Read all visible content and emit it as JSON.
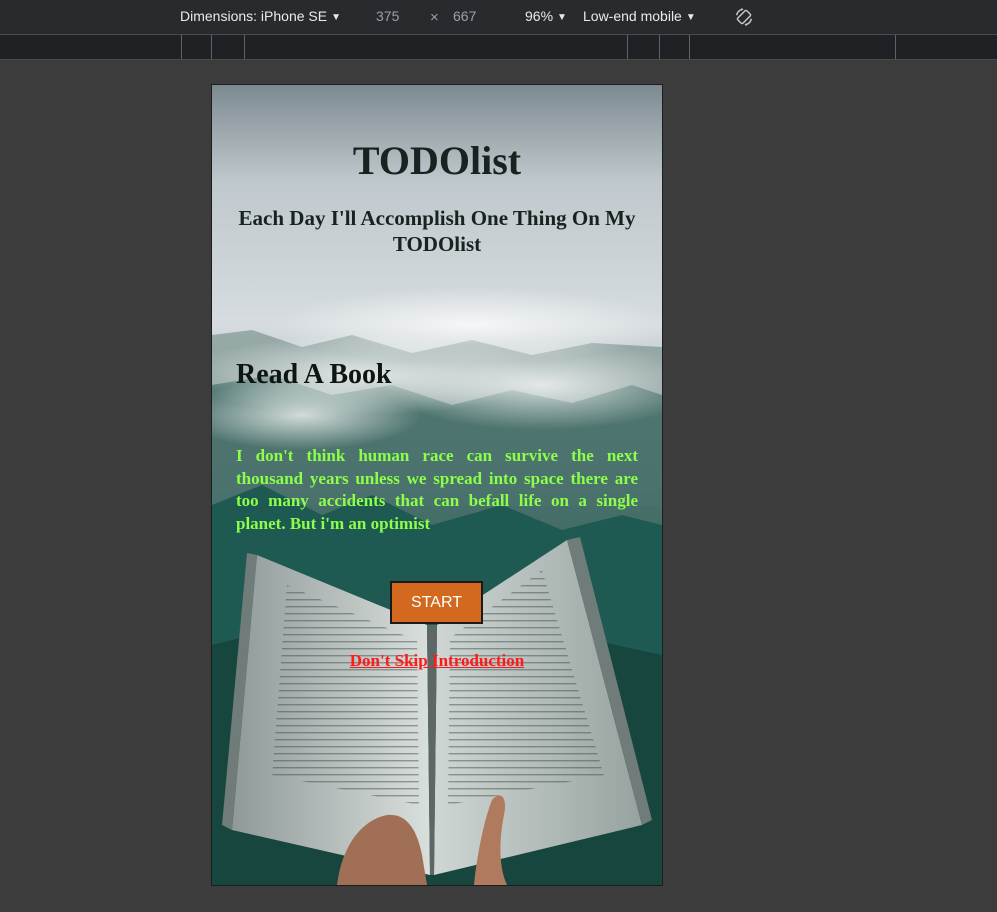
{
  "devtools": {
    "device_label": "Dimensions: iPhone SE",
    "width_value": "375",
    "height_value": "667",
    "zoom": "96%",
    "throttle": "Low-end mobile",
    "times_symbol": "×"
  },
  "app": {
    "title": "TODOlist",
    "tagline": "Each Day I'll Accomplish One Thing On My TODOlist",
    "task_heading": "Read A Book",
    "quote": "I don't think human race can survive the next thousand years unless we spread into space there are too many accidents that can befall life on a single planet. But i'm an optimist",
    "start_button": "START",
    "skip_link": "Don't Skip Introduction"
  },
  "colors": {
    "accent_button": "#d2691e",
    "quote_text": "#8cff4a",
    "link_text": "#ff1a1a",
    "title_text": "#16231f"
  }
}
